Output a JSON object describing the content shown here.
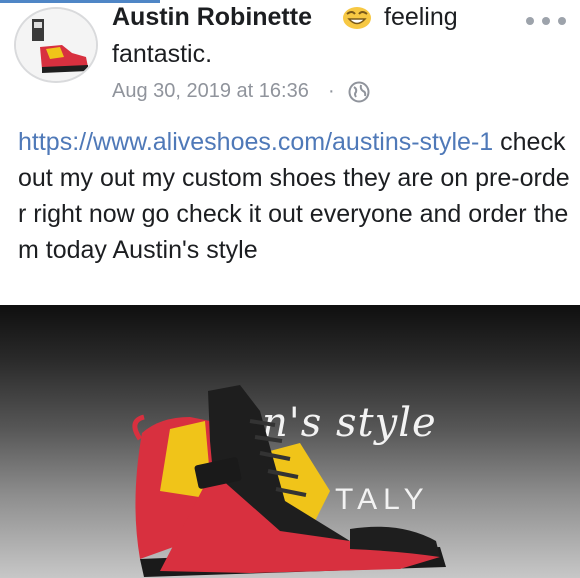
{
  "post": {
    "author": "Austin Robinette",
    "feeling_word": "feeling",
    "feeling_value": "fantastic.",
    "timestamp": "Aug 30, 2019 at 16:36",
    "separator": "·",
    "link_text": "https://www.aliveshoes.com/austins-style-1",
    "body_text": " check out my out my custom shoes they are on pre-order right now go check it out everyone and order them today Austin's style",
    "icons": [
      "avatar",
      "grinning-emoji-icon",
      "globe-icon",
      "more-options-icon"
    ]
  },
  "media": {
    "brand_text": "n's style",
    "brand_sub": "TALY"
  },
  "colors": {
    "link": "#4f79b8",
    "meta": "#90949c",
    "shoe_red": "#d8303f",
    "shoe_yellow": "#f0c419",
    "shoe_black": "#1e1e1e"
  }
}
